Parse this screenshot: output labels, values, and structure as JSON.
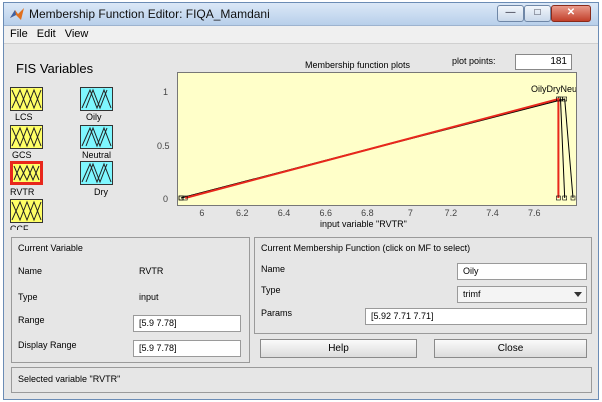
{
  "window": {
    "title": "Membership Function Editor: FIQA_Mamdani"
  },
  "menu": [
    "File",
    "Edit",
    "View"
  ],
  "fis_variables": {
    "title": "FIS Variables",
    "inputs": [
      {
        "label": "LCS",
        "selected": false
      },
      {
        "label": "GCS",
        "selected": false
      },
      {
        "label": "RVTR",
        "selected": true
      },
      {
        "label": "CCF",
        "selected": false
      }
    ],
    "outputs": [
      {
        "label": "Oily"
      },
      {
        "label": "Neutral"
      },
      {
        "label": "Dry"
      }
    ],
    "colors": {
      "input": "#ffff66",
      "output": "#7ff7ff",
      "selected_border": "#e8271c"
    }
  },
  "plot": {
    "header": "Membership function plots",
    "plot_points_label": "plot points:",
    "plot_points_value": "181",
    "xlabel": "input variable \"RVTR\"",
    "x_ticks": [
      "6",
      "6.2",
      "6.4",
      "6.6",
      "6.8",
      "7",
      "7.2",
      "7.4",
      "7.6"
    ],
    "y_ticks": [
      "0",
      "0.5",
      "1"
    ],
    "mf_names_overlap": "OilyDryNeutral",
    "chart_data": {
      "type": "line",
      "xlim": [
        5.9,
        7.78
      ],
      "ylim": [
        0,
        1
      ],
      "series": [
        {
          "name": "Oily",
          "color": "#e8271c",
          "type": "trimf",
          "params": [
            5.92,
            7.71,
            7.71
          ]
        },
        {
          "name": "Neutral",
          "color": "#000000",
          "type": "trimf",
          "params": [
            5.9,
            7.72,
            7.74
          ]
        },
        {
          "name": "Dry",
          "color": "#000000",
          "type": "trimf",
          "params": [
            5.9,
            7.74,
            7.78
          ]
        }
      ]
    }
  },
  "current_variable": {
    "title": "Current Variable",
    "name_label": "Name",
    "name_value": "RVTR",
    "type_label": "Type",
    "type_value": "input",
    "range_label": "Range",
    "range_value": "[5.9 7.78]",
    "display_range_label": "Display Range",
    "display_range_value": "[5.9 7.78]"
  },
  "current_mf": {
    "title": "Current Membership Function (click on MF to select)",
    "name_label": "Name",
    "name_value": "Oily",
    "type_label": "Type",
    "type_value": "trimf",
    "params_label": "Params",
    "params_value": "[5.92 7.71 7.71]"
  },
  "buttons": {
    "help": "Help",
    "close": "Close"
  },
  "status": "Selected variable \"RVTR\""
}
